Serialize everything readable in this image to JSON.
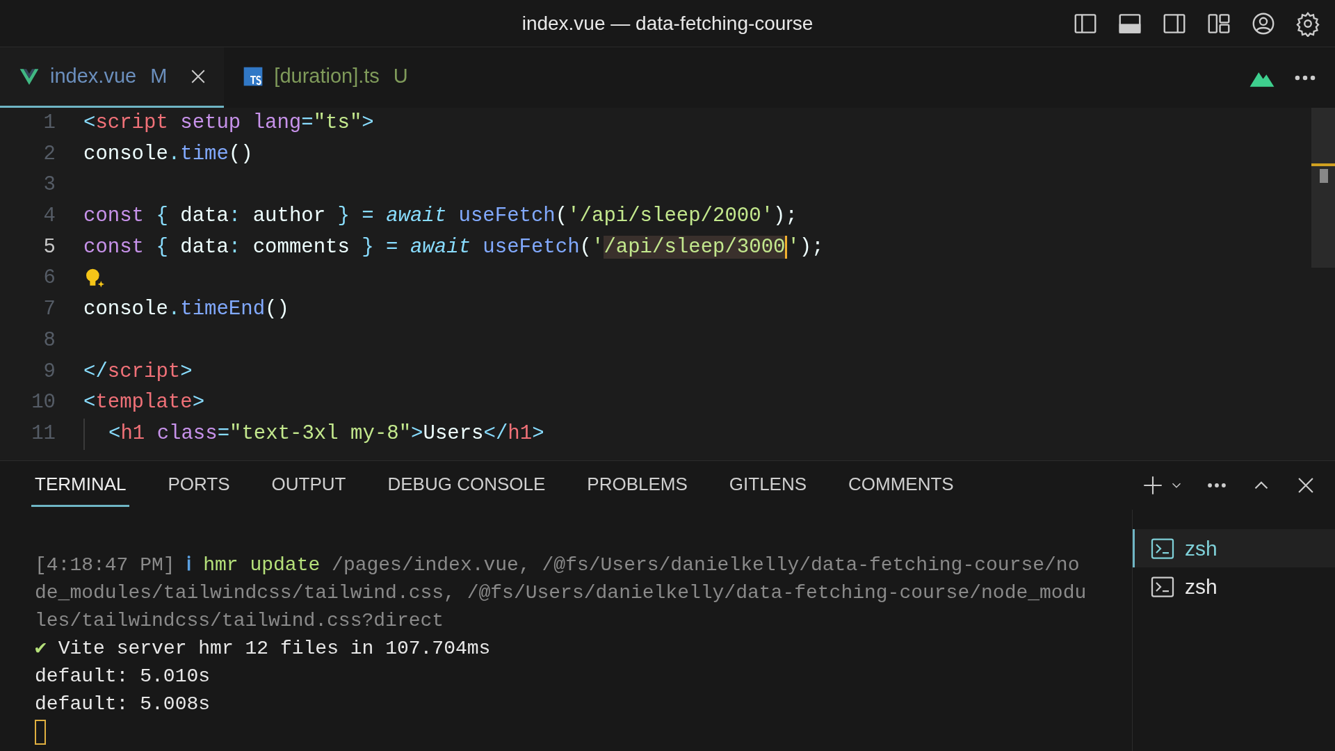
{
  "window": {
    "title": "index.vue — data-fetching-course"
  },
  "editor_tabs": [
    {
      "label": "index.vue",
      "status": "M",
      "selected": true
    },
    {
      "label": "[duration].ts",
      "status": "U",
      "selected": false
    }
  ],
  "code_lines": [
    {
      "number": "1",
      "current": false,
      "tokens": [
        {
          "text": "<",
          "kind": "punct"
        },
        {
          "text": "script ",
          "kind": "tag"
        },
        {
          "text": "setup ",
          "kind": "attr"
        },
        {
          "text": "lang",
          "kind": "attr"
        },
        {
          "text": "=",
          "kind": "punct"
        },
        {
          "text": "\"ts\"",
          "kind": "string"
        },
        {
          "text": ">",
          "kind": "punct"
        }
      ]
    },
    {
      "number": "2",
      "current": false,
      "tokens": [
        {
          "text": "console",
          "kind": "plain"
        },
        {
          "text": ".",
          "kind": "punct"
        },
        {
          "text": "time",
          "kind": "func"
        },
        {
          "text": "()",
          "kind": "plain"
        }
      ]
    },
    {
      "number": "3",
      "current": false
    },
    {
      "number": "4",
      "current": false,
      "tokens": [
        {
          "text": "const ",
          "kind": "keyword"
        },
        {
          "text": "{ ",
          "kind": "punct"
        },
        {
          "text": "data",
          "kind": "plain"
        },
        {
          "text": ": ",
          "kind": "punct"
        },
        {
          "text": "author ",
          "kind": "plain"
        },
        {
          "text": "} = ",
          "kind": "punct"
        },
        {
          "text": "await ",
          "kind": "italic"
        },
        {
          "text": "useFetch",
          "kind": "func"
        },
        {
          "text": "(",
          "kind": "plain"
        },
        {
          "text": "'/api/sleep/2000'",
          "kind": "string"
        },
        {
          "text": ");",
          "kind": "plain"
        }
      ]
    },
    {
      "number": "5",
      "current": true,
      "tokens": [
        {
          "text": "const ",
          "kind": "keyword"
        },
        {
          "text": "{ ",
          "kind": "punct"
        },
        {
          "text": "data",
          "kind": "plain"
        },
        {
          "text": ": ",
          "kind": "punct"
        },
        {
          "text": "comments ",
          "kind": "plain"
        },
        {
          "text": "} = ",
          "kind": "punct"
        },
        {
          "text": "await ",
          "kind": "italic"
        },
        {
          "text": "useFetch",
          "kind": "func"
        },
        {
          "text": "(",
          "kind": "plain"
        },
        {
          "text": "'",
          "kind": "string"
        },
        {
          "text": "/api/sleep/3000",
          "kind": "string",
          "highlighted": true,
          "caret": true
        },
        {
          "text": "'",
          "kind": "string"
        },
        {
          "text": ");",
          "kind": "plain"
        }
      ]
    },
    {
      "number": "6",
      "current": false,
      "lightbulb": true
    },
    {
      "number": "7",
      "current": false,
      "tokens": [
        {
          "text": "console",
          "kind": "plain"
        },
        {
          "text": ".",
          "kind": "punct"
        },
        {
          "text": "timeEnd",
          "kind": "func"
        },
        {
          "text": "()",
          "kind": "plain"
        }
      ]
    },
    {
      "number": "8",
      "current": false
    },
    {
      "number": "9",
      "current": false,
      "tokens": [
        {
          "text": "</",
          "kind": "punct"
        },
        {
          "text": "script",
          "kind": "tag"
        },
        {
          "text": ">",
          "kind": "punct"
        }
      ]
    },
    {
      "number": "10",
      "current": false,
      "tokens": [
        {
          "text": "<",
          "kind": "punct"
        },
        {
          "text": "template",
          "kind": "tag"
        },
        {
          "text": ">",
          "kind": "punct"
        }
      ]
    },
    {
      "number": "11",
      "current": false,
      "indented": true,
      "tokens": [
        {
          "text": "<",
          "kind": "punct"
        },
        {
          "text": "h1 ",
          "kind": "tag"
        },
        {
          "text": "class",
          "kind": "attr"
        },
        {
          "text": "=",
          "kind": "punct"
        },
        {
          "text": "\"text-3xl my-8\"",
          "kind": "string"
        },
        {
          "text": ">",
          "kind": "punct"
        },
        {
          "text": "Users",
          "kind": "plain"
        },
        {
          "text": "</",
          "kind": "punct"
        },
        {
          "text": "h1",
          "kind": "tag"
        },
        {
          "text": ">",
          "kind": "punct"
        }
      ]
    }
  ],
  "panel_tabs": [
    {
      "label": "TERMINAL",
      "selected": true
    },
    {
      "label": "PORTS",
      "selected": false
    },
    {
      "label": "OUTPUT",
      "selected": false
    },
    {
      "label": "DEBUG CONSOLE",
      "selected": false
    },
    {
      "label": "PROBLEMS",
      "selected": false
    },
    {
      "label": "GITLENS",
      "selected": false
    },
    {
      "label": "COMMENTS",
      "selected": false
    }
  ],
  "terminal": {
    "rows": [
      {
        "segments": [
          {
            "text": "[4:18:47 PM] ",
            "kind": "dim"
          },
          {
            "text": "ℹ",
            "kind": "info"
          },
          {
            "text": " hmr update ",
            "kind": "success"
          },
          {
            "text": "/pages/index.vue, /@fs/Users/danielkelly/data-fetching-course/no",
            "kind": "dim"
          }
        ]
      },
      {
        "segments": [
          {
            "text": "de_modules/tailwindcss/tailwind.css, /@fs/Users/danielkelly/data-fetching-course/node_modu",
            "kind": "dim"
          }
        ]
      },
      {
        "segments": [
          {
            "text": "les/tailwindcss/tailwind.css?direct",
            "kind": "dim"
          }
        ]
      },
      {
        "segments": [
          {
            "text": "✔",
            "kind": "success"
          },
          {
            "text": " Vite server hmr 12 files in 107.704ms",
            "kind": "plain"
          }
        ]
      },
      {
        "segments": [
          {
            "text": "default: 5.010s",
            "kind": "plain"
          }
        ]
      },
      {
        "segments": [
          {
            "text": "default: 5.008s",
            "kind": "plain"
          }
        ]
      }
    ],
    "cursor": true
  },
  "terminal_list": [
    {
      "label": "zsh",
      "selected": true
    },
    {
      "label": "zsh",
      "selected": false
    }
  ]
}
